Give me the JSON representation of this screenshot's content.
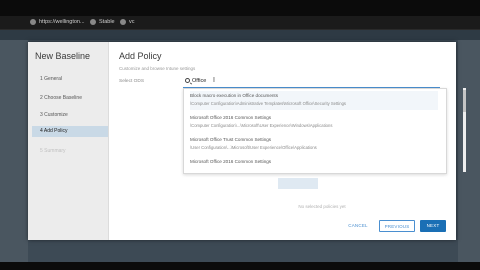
{
  "browser": {
    "tabs": [
      {
        "label": "https://wellington..."
      },
      {
        "label": "Stable"
      },
      {
        "label": "vc"
      }
    ]
  },
  "wizard": {
    "title": "New Baseline",
    "steps": [
      {
        "label": "1 General"
      },
      {
        "label": "2 Choose Baseline"
      },
      {
        "label": "3 Customize"
      },
      {
        "label": "4 Add Policy"
      },
      {
        "label": "5 Summary"
      }
    ]
  },
  "panel": {
    "title": "Add Policy",
    "subtitle": "Customize and browse Intune settings",
    "select_label": "Select ODS",
    "search_value": "Office",
    "results": [
      {
        "title": "Block macro execution in Office documents",
        "path": "\\Computer Configuration\\Administrative Templates\\Microsoft Office\\Security Settings"
      },
      {
        "title": "Microsoft Office 2016 Common Settings",
        "path": "\\Computer Configuration\\...\\Microsoft\\User Experience\\Windows\\Applications"
      },
      {
        "title": "Microsoft Office Trust Common Settings",
        "path": "\\User Configuration\\...\\Microsoft\\User Experience\\Office\\Applications"
      },
      {
        "title": "Microsoft Office 2016 Common Settings",
        "path": ""
      }
    ],
    "empty_text": "No selected policies yet"
  },
  "buttons": {
    "cancel": "CANCEL",
    "previous": "PREVIOUS",
    "next": "NEXT"
  }
}
